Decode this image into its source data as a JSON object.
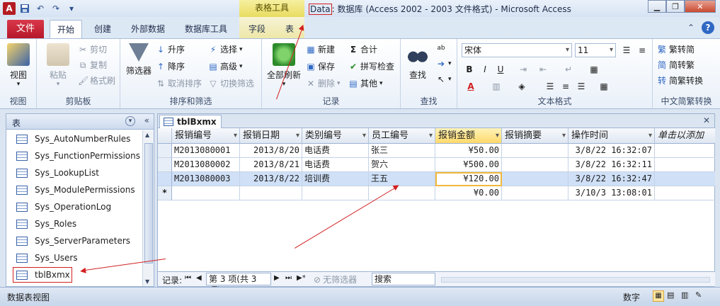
{
  "qat": {
    "app_icon": "A",
    "save_icon": "save-icon",
    "undo_icon": "undo-icon",
    "redo_icon": "redo-icon",
    "customize_icon": "customize-qat-icon"
  },
  "context_tab_group": "表格工具",
  "window_title": {
    "db_name": "Data",
    "rest": ": 数据库 (Access 2002 - 2003 文件格式)  -  Microsoft Access"
  },
  "tabs": {
    "file": "文件",
    "items": [
      "开始",
      "创建",
      "外部数据",
      "数据库工具",
      "字段",
      "表"
    ],
    "active": "开始"
  },
  "ribbon": {
    "views": {
      "view": "视图",
      "label": "视图"
    },
    "clipboard": {
      "paste": "粘贴",
      "cut": "剪切",
      "copy": "复制",
      "format_painter": "格式刷",
      "label": "剪贴板"
    },
    "sort_filter": {
      "filter": "筛选器",
      "asc": "升序",
      "desc": "降序",
      "clear_sort": "取消排序",
      "select": "选择",
      "advanced": "高级",
      "toggle_filter": "切换筛选",
      "label": "排序和筛选"
    },
    "records": {
      "refresh_all": "全部刷新",
      "new": "新建",
      "save": "保存",
      "delete": "删除",
      "totals": "合计",
      "spelling": "拼写检查",
      "more": "其他",
      "label": "记录"
    },
    "find": {
      "find": "查找",
      "label": "查找"
    },
    "text_format": {
      "font": "宋体",
      "size": "11",
      "bold": "B",
      "italic": "I",
      "underline": "U",
      "label": "文本格式"
    },
    "chinese_conv": {
      "t2s": "繁转简",
      "s2t": "简转繁",
      "convert": "简繁转换",
      "label": "中文简繁转换"
    }
  },
  "nav_pane": {
    "title": "表",
    "items": [
      "Sys_AutoNumberRules",
      "Sys_FunctionPermissions",
      "Sys_LookupList",
      "Sys_ModulePermissions",
      "Sys_OperationLog",
      "Sys_Roles",
      "Sys_ServerParameters",
      "Sys_Users",
      "tblBxmx"
    ],
    "selected": "tblBxmx"
  },
  "document": {
    "tab_title": "tblBxmx",
    "columns": [
      "报销编号",
      "报销日期",
      "类别编号",
      "员工编号",
      "报销金额",
      "报销摘要",
      "操作时间",
      "单击以添加"
    ],
    "rows": [
      [
        "M2013080001",
        "2013/8/20",
        "电话费",
        "张三",
        "¥50.00",
        "",
        "3/8/22 16:32:07",
        ""
      ],
      [
        "M2013080002",
        "2013/8/21",
        "电话费",
        "贺六",
        "¥500.00",
        "",
        "3/8/22 16:32:11",
        ""
      ],
      [
        "M2013080003",
        "2013/8/22",
        "培训费",
        "王五",
        "¥120.00",
        "",
        "3/8/22 16:32:47",
        ""
      ]
    ],
    "new_row": {
      "marker": "*",
      "amount": "¥0.00",
      "time": "3/10/3 13:08:01"
    },
    "record_nav": {
      "label": "记录:",
      "position": "第 3 项(共 3 项)",
      "no_filter": "无筛选器",
      "search": "搜索"
    }
  },
  "status_bar": {
    "left": "数据表视图",
    "mode": "数字"
  },
  "colors": {
    "file_tab": "#c42030",
    "annotation": "#d12020",
    "selected_row": "#cfe0f7",
    "hot_header": "#ffd96a"
  }
}
